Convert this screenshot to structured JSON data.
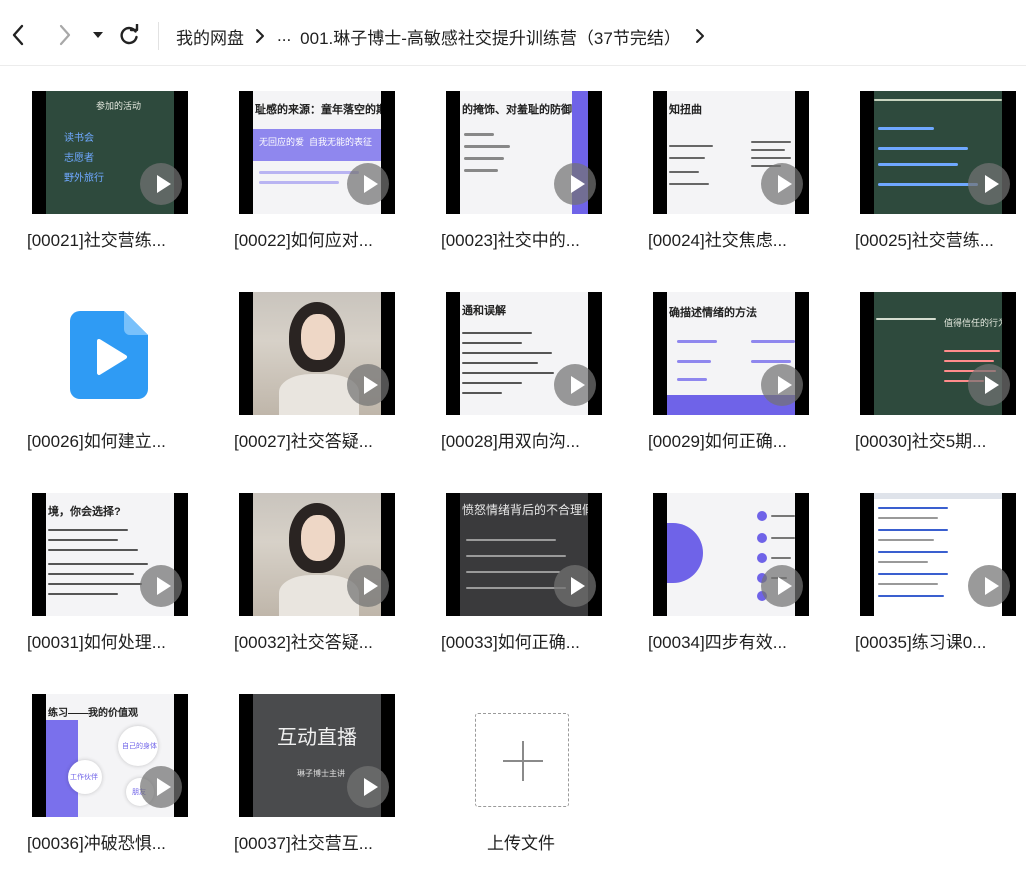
{
  "breadcrumb": {
    "root": "我的网盘",
    "ellipsis": "...",
    "current": "001.琳子博士-高敏感社交提升训练营（37节完结）"
  },
  "files": [
    {
      "name": "[00021]社交营练...",
      "thumb_text": [
        "参加的活动",
        "读书会",
        "志愿者",
        "野外旅行"
      ]
    },
    {
      "name": "[00022]如何应对...",
      "thumb_text": [
        "耻感的来源：童年落空的期待",
        "无回应的爱",
        "自我无能的表征"
      ]
    },
    {
      "name": "[00023]社交中的...",
      "thumb_text": [
        "的掩饰、对羞耻的防御"
      ]
    },
    {
      "name": "[00024]社交焦虑...",
      "thumb_text": [
        "知扭曲"
      ]
    },
    {
      "name": "[00025]社交营练...",
      "thumb_text": []
    },
    {
      "name": "[00026]如何建立...",
      "thumb_text": []
    },
    {
      "name": "[00027]社交答疑...",
      "thumb_text": []
    },
    {
      "name": "[00028]用双向沟...",
      "thumb_text": [
        "通和误解"
      ]
    },
    {
      "name": "[00029]如何正确...",
      "thumb_text": [
        "确描述情绪的方法"
      ]
    },
    {
      "name": "[00030]社交5期...",
      "thumb_text": [
        "值得信任的行为"
      ]
    },
    {
      "name": "[00031]如何处理...",
      "thumb_text": [
        "境，你会选择?"
      ]
    },
    {
      "name": "[00032]社交答疑...",
      "thumb_text": []
    },
    {
      "name": "[00033]如何正确...",
      "thumb_text": [
        "愤怒情绪背后的不合理假设"
      ]
    },
    {
      "name": "[00034]四步有效...",
      "thumb_text": []
    },
    {
      "name": "[00035]练习课0...",
      "thumb_text": []
    },
    {
      "name": "[00036]冲破恐惧...",
      "thumb_text": [
        "练习——我的价值观",
        "自己的身体",
        "工作伙伴",
        "朋友"
      ]
    },
    {
      "name": "[00037]社交营互...",
      "thumb_text": [
        "互动直播",
        "琳子博士主讲"
      ]
    }
  ],
  "upload": {
    "label": "上传文件"
  },
  "colors": {
    "accent_purple": "#6f63e8",
    "video_blue": "#2f9bf4",
    "chalkboard": "#2e4a3d"
  }
}
